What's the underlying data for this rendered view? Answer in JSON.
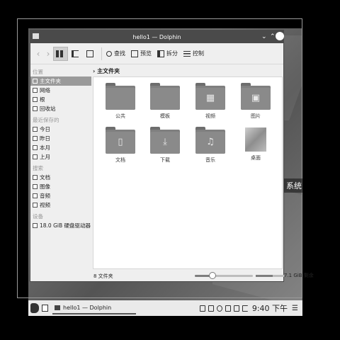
{
  "desktop": {
    "side_label": "系统"
  },
  "window": {
    "title": "hello1 — Dolphin"
  },
  "toolbar": {
    "search": "查找",
    "preview": "预览",
    "split": "拆分",
    "control": "控制"
  },
  "sidebar": {
    "places_header": "位置",
    "places": [
      {
        "label": "主文件夹",
        "icon": "home-icon"
      },
      {
        "label": "网络",
        "icon": "network-icon"
      },
      {
        "label": "根",
        "icon": "root-icon"
      },
      {
        "label": "回收站",
        "icon": "trash-icon"
      }
    ],
    "recent_header": "最近保存的",
    "recent": [
      {
        "label": "今日",
        "icon": "calendar-icon"
      },
      {
        "label": "昨日",
        "icon": "calendar-icon"
      },
      {
        "label": "本月",
        "icon": "calendar-icon"
      },
      {
        "label": "上月",
        "icon": "calendar-icon"
      }
    ],
    "search_header": "搜索",
    "search": [
      {
        "label": "文档",
        "icon": "document-icon"
      },
      {
        "label": "图像",
        "icon": "image-icon"
      },
      {
        "label": "音频",
        "icon": "music-icon"
      },
      {
        "label": "视频",
        "icon": "video-icon"
      }
    ],
    "devices_header": "设备",
    "devices": [
      {
        "label": "18.0 GiB 硬盘驱动器",
        "icon": "harddrive-icon"
      }
    ]
  },
  "breadcrumb": {
    "current": "主文件夹"
  },
  "files": [
    {
      "label": "公共",
      "icon": "folder-icon",
      "glyph": ""
    },
    {
      "label": "模板",
      "icon": "folder-icon",
      "glyph": ""
    },
    {
      "label": "视频",
      "icon": "folder-video-icon",
      "glyph": "▦"
    },
    {
      "label": "图片",
      "icon": "folder-pictures-icon",
      "glyph": "▣"
    },
    {
      "label": "文档",
      "icon": "folder-documents-icon",
      "glyph": "▯"
    },
    {
      "label": "下载",
      "icon": "folder-download-icon",
      "glyph": "⤓"
    },
    {
      "label": "音乐",
      "icon": "folder-music-icon",
      "glyph": "♫"
    },
    {
      "label": "桌面",
      "icon": "desktop-thumbnail",
      "glyph": ""
    }
  ],
  "status": {
    "count": "8 文件夹",
    "free_space": "7.1 GiB 剩余",
    "zoom_fraction": 0.3,
    "used_fraction": 0.6
  },
  "taskbar": {
    "task": "hello1 — Dolphin",
    "clock": "9:40 下午"
  }
}
